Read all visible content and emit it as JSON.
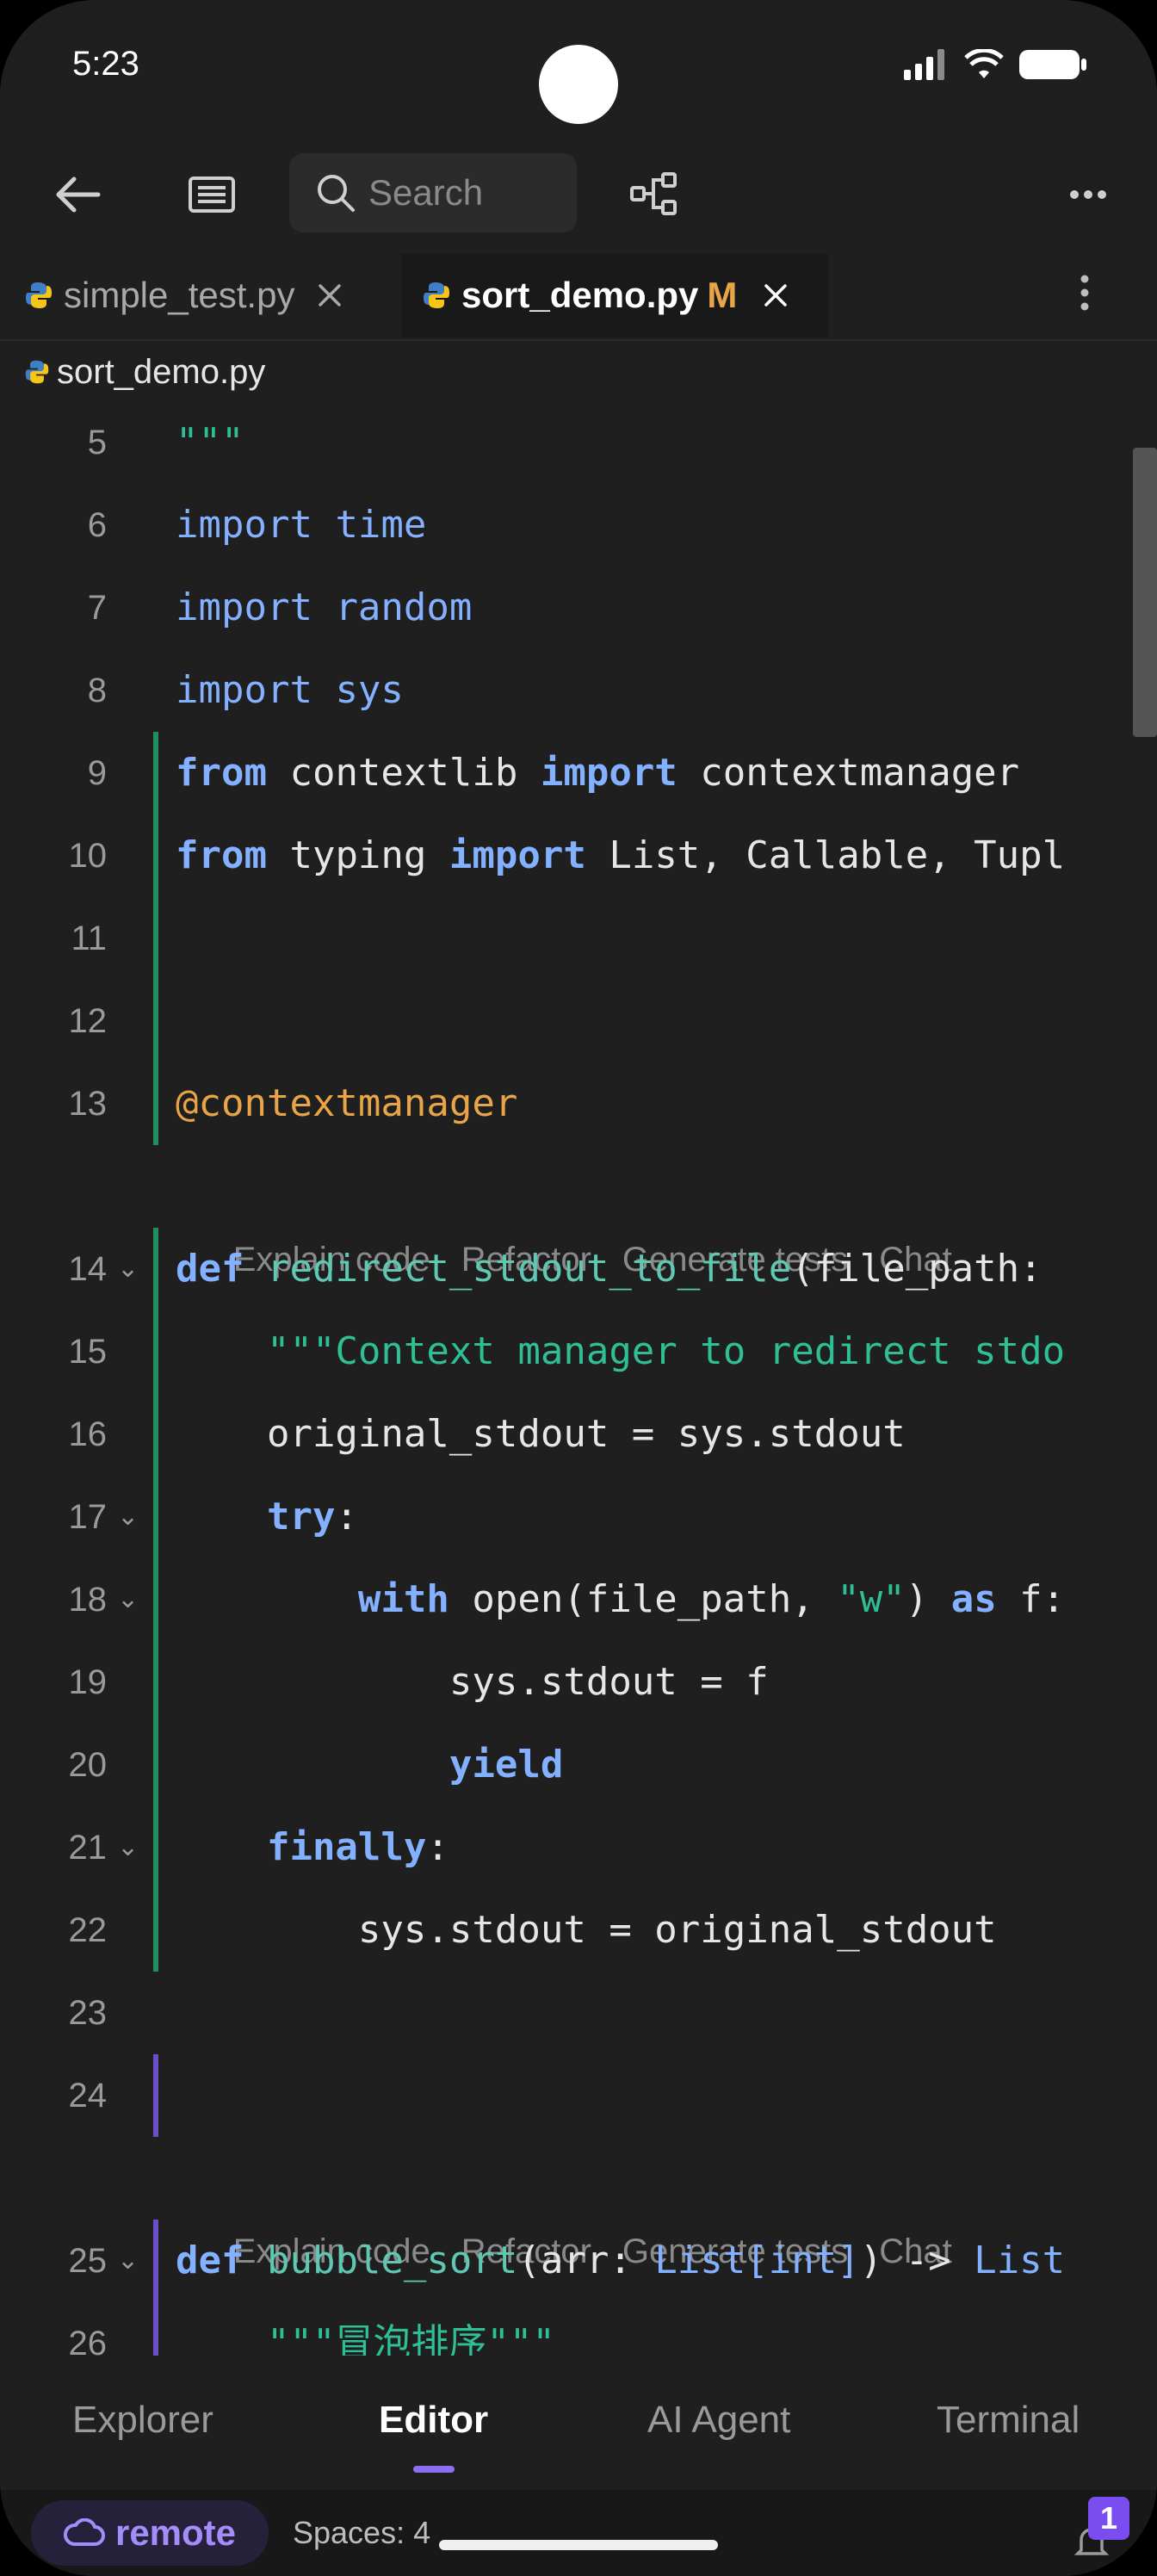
{
  "status_bar": {
    "time": "5:23"
  },
  "toolbar": {
    "search_placeholder": "Search"
  },
  "tabs": [
    {
      "label": "simple_test.py",
      "modified": "",
      "active": false
    },
    {
      "label": "sort_demo.py",
      "modified": "M",
      "active": true
    }
  ],
  "breadcrumb": {
    "file": "sort_demo.py"
  },
  "codelens": [
    "Explain code",
    "Refactor",
    "Generate tests",
    "Chat"
  ],
  "lines": [
    {
      "n": "5"
    },
    {
      "n": "6"
    },
    {
      "n": "7"
    },
    {
      "n": "8"
    },
    {
      "n": "9"
    },
    {
      "n": "10"
    },
    {
      "n": "11"
    },
    {
      "n": "12"
    },
    {
      "n": "13"
    },
    {
      "n": "14"
    },
    {
      "n": "15"
    },
    {
      "n": "16"
    },
    {
      "n": "17"
    },
    {
      "n": "18"
    },
    {
      "n": "19"
    },
    {
      "n": "20"
    },
    {
      "n": "21"
    },
    {
      "n": "22"
    },
    {
      "n": "23"
    },
    {
      "n": "24"
    },
    {
      "n": "25"
    },
    {
      "n": "26"
    }
  ],
  "code_tokens": {
    "l5": "\"\"\"",
    "l6a": "import",
    "l6b": " time",
    "l7a": "import",
    "l7b": " random",
    "l8a": "import",
    "l8b": " sys",
    "l9a": "from",
    "l9b": " contextlib ",
    "l9c": "import",
    "l9d": " contextmanager",
    "l10a": "from",
    "l10b": " typing ",
    "l10c": "import",
    "l10d": " List, Callable, Tupl",
    "l13": "@contextmanager",
    "l14a": "def",
    "l14b": " redirect_stdout_to_file",
    "l14c": "(file_path:",
    "l15": "    \"\"\"Context manager to redirect stdo",
    "l16": "    original_stdout = sys.stdout",
    "l17a": "    try",
    "l17b": ":",
    "l18a": "        with",
    "l18b": " open(file_path, ",
    "l18c": "\"w\"",
    "l18d": ") ",
    "l18e": "as",
    "l18f": " f:",
    "l19": "            sys.stdout = f",
    "l20": "            yield",
    "l21a": "    finally",
    "l21b": ":",
    "l22": "        sys.stdout = original_stdout",
    "l25a": "def",
    "l25b": " bubble_sort",
    "l25c": "(arr: ",
    "l25d": "List[int]",
    "l25e": ") -> ",
    "l25f": "List",
    "l26": "    \"\"\"冒泡排序\"\"\""
  },
  "bottom_nav": {
    "explorer": "Explorer",
    "editor": "Editor",
    "agent": "AI Agent",
    "terminal": "Terminal"
  },
  "footer": {
    "remote": "remote",
    "spaces": "Spaces: 4",
    "notifications": "1"
  },
  "colors": {
    "accent": "#8c6ff0",
    "keyword": "#84b1ff",
    "string": "#2fbf95",
    "decorator": "#e8a547",
    "function": "#5fc8b2",
    "modified": "#e8a547"
  }
}
